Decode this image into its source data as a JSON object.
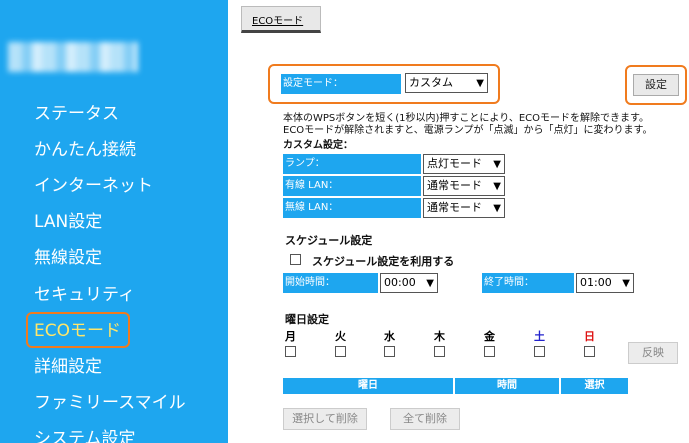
{
  "sidebar": {
    "items": [
      {
        "label": "ステータス"
      },
      {
        "label": "かんたん接続"
      },
      {
        "label": "インターネット"
      },
      {
        "label": "LAN設定"
      },
      {
        "label": "無線設定"
      },
      {
        "label": "セキュリティ"
      },
      {
        "label": "ECOモード"
      },
      {
        "label": "詳細設定"
      },
      {
        "label": "ファミリースマイル"
      },
      {
        "label": "システム設定"
      }
    ]
  },
  "page": {
    "tab_title": "ECOモード"
  },
  "eco": {
    "mode_label": "設定モード：",
    "mode_value": "カスタム",
    "set_button": "設定",
    "description_line1": "本体のWPSボタンを短く(1秒以内)押すことにより、ECOモードを解除できます。",
    "description_line2": "ECOモードが解除されますと、電源ランプが「点滅」から「点灯」に変わります。",
    "custom_heading": "カスタム設定：",
    "rows": [
      {
        "label": "ランプ：",
        "value": "点灯モード"
      },
      {
        "label": "有線 LAN：",
        "value": "通常モード"
      },
      {
        "label": "無線 LAN：",
        "value": "通常モード"
      }
    ]
  },
  "schedule": {
    "heading": "スケジュール設定",
    "use_label": "スケジュール設定を利用する",
    "start_label": "開始時間：",
    "start_value": "00:00",
    "end_label": "終了時間：",
    "end_value": "01:00",
    "weekday_heading": "曜日設定",
    "days": [
      "月",
      "火",
      "水",
      "木",
      "金",
      "土",
      "日"
    ],
    "reflect_button": "反映",
    "table_headers": [
      "曜日",
      "時間",
      "選択"
    ],
    "delete_selected": "選択して削除",
    "delete_all": "全て削除"
  },
  "colors": {
    "accent": "#1ea6ef",
    "highlight": "#f07b1e",
    "saturday": "#2222cc",
    "sunday": "#dd1111"
  }
}
